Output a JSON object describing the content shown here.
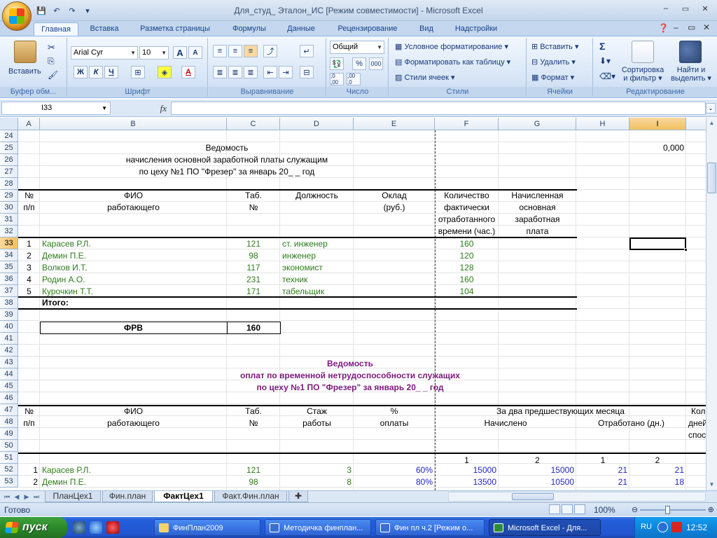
{
  "window": {
    "title": "Для_студ_ Эталон_ИС  [Режим совместимости] - Microsoft Excel",
    "controls": {
      "minimize": "–",
      "restore": "▭",
      "close": "✕"
    }
  },
  "qat": {
    "save": "💾",
    "undo": "↶",
    "redo": "↷",
    "more": "▾"
  },
  "tabs": [
    "Главная",
    "Вставка",
    "Разметка страницы",
    "Формулы",
    "Данные",
    "Рецензирование",
    "Вид",
    "Надстройки"
  ],
  "tab_active": "Главная",
  "ribbon": {
    "clipboard": {
      "label": "Буфер обм...",
      "paste": "Вставить"
    },
    "font": {
      "label": "Шрифт",
      "name": "Arial Cyr",
      "size": "10",
      "bold": "Ж",
      "italic": "К",
      "underline": "Ч",
      "grow": "A",
      "shrink": "A"
    },
    "alignment": {
      "label": "Выравнивание"
    },
    "number": {
      "label": "Число",
      "format": "Общий",
      "percent": "%",
      "thousands": "000",
      "inc_dec": ",0 ,00",
      "dec_dec": ",00 ,0"
    },
    "styles": {
      "label": "Стили",
      "conditional": "Условное форматирование",
      "as_table": "Форматировать как таблицу",
      "cell_styles": "Стили ячеек"
    },
    "cells": {
      "label": "Ячейки",
      "insert": "Вставить",
      "delete": "Удалить",
      "format": "Формат"
    },
    "editing": {
      "label": "Редактирование",
      "sort": "Сортировка и фильтр",
      "sort_line1": "Сортировка",
      "sort_line2": "и фильтр",
      "find": "Найти и выделить",
      "find_line1": "Найти и",
      "find_line2": "выделить",
      "sigma": "Σ"
    }
  },
  "formula_bar": {
    "name_box": "I33",
    "fx": "fx",
    "value": ""
  },
  "columns": [
    "A",
    "B",
    "C",
    "D",
    "E",
    "F",
    "G",
    "H",
    "I"
  ],
  "selected_column": "I",
  "rows": [
    "24",
    "25",
    "26",
    "27",
    "28",
    "29",
    "30",
    "31",
    "32",
    "33",
    "34",
    "35",
    "36",
    "37",
    "38",
    "39",
    "40",
    "41",
    "42",
    "43",
    "44",
    "45",
    "46",
    "47",
    "48",
    "49",
    "50",
    "51",
    "52",
    "53"
  ],
  "selected_row": "33",
  "sheet": {
    "t1_title1": "Ведомость",
    "t1_title2": "начисления основной заработной платы служащим",
    "t1_title3": "по цеху №1 ПО \"Фрезер\" за январь 20_ _  год",
    "i25": "0,000",
    "t1_hdr": {
      "a": [
        "№",
        "п/п"
      ],
      "b": [
        "ФИО",
        "работающего"
      ],
      "c": [
        "Таб.",
        "№"
      ],
      "d": [
        "Должность"
      ],
      "e": [
        "Оклад",
        "(руб.)"
      ],
      "f": [
        "Количество",
        "фактически",
        "отработанного",
        "времени (час.)"
      ],
      "g": [
        "Начисленная",
        "основная",
        "заработная",
        "плата"
      ]
    },
    "t1_rows": [
      {
        "n": "1",
        "fio": "Карасев Р.Л.",
        "tab": "121",
        "pos": "ст. инженер",
        "hours": "160"
      },
      {
        "n": "2",
        "fio": "Демин П.Е.",
        "tab": "98",
        "pos": "инженер",
        "hours": "120"
      },
      {
        "n": "3",
        "fio": "Волков И.Т.",
        "tab": "117",
        "pos": "экономист",
        "hours": "128"
      },
      {
        "n": "4",
        "fio": "Родин А.О.",
        "tab": "231",
        "pos": "техник",
        "hours": "160"
      },
      {
        "n": "5",
        "fio": "Курочкин Т.Т.",
        "tab": "171",
        "pos": "табельщик",
        "hours": "104"
      }
    ],
    "total_label": "Итого:",
    "frv_label": "ФРВ",
    "frv_value": "160",
    "t2_title1": "Ведомость",
    "t2_title2": "оплат по временной нетрудоспособности служащих",
    "t2_title3": "по цеху №1 ПО \"Фрезер\" за январь 20_ _  год",
    "t2_hdr": {
      "a": [
        "№",
        "п/п"
      ],
      "b": [
        "ФИО",
        "работающего"
      ],
      "c": [
        "Таб.",
        "№"
      ],
      "d": [
        "Стаж",
        "работы"
      ],
      "e": [
        "%",
        "оплаты"
      ],
      "fg": "За два предшествующих месяца",
      "accrued": "Начислено",
      "worked": "Отработано (дн.)",
      "i_top": "Кол",
      "i_mid": "дней",
      "i_bot": "спос",
      "nums": [
        "1",
        "2",
        "1",
        "2"
      ]
    },
    "t2_rows": [
      {
        "n": "1",
        "fio": "Карасев Р.Л.",
        "tab": "121",
        "exp": "3",
        "pct": "60%",
        "f": "15000",
        "g": "15000",
        "h": "21",
        "i": "21"
      },
      {
        "n": "2",
        "fio": "Демин П.Е.",
        "tab": "98",
        "exp": "8",
        "pct": "80%",
        "f": "13500",
        "g": "10500",
        "h": "21",
        "i": "18"
      }
    ]
  },
  "sheet_tabs": [
    "ПланЦех1",
    "Фин.план",
    "ФактЦех1",
    "Факт.Фин.план"
  ],
  "sheet_tab_active": "ФактЦех1",
  "status": {
    "ready": "Готово",
    "zoom": "100%"
  },
  "taskbar": {
    "start": "пуск",
    "tasks": [
      "ФинПлан2009",
      "Методичка финплан...",
      "Фин пл ч.2 [Режим о...",
      "Microsoft Excel - Для..."
    ],
    "active_task": "Microsoft Excel - Для...",
    "lang": "RU",
    "clock": "12:52"
  },
  "colors": {
    "green_text": "#2d7b1a",
    "purple_text": "#7a1a7a",
    "blue_text": "#2323c8",
    "selection": "#f1c15f"
  }
}
